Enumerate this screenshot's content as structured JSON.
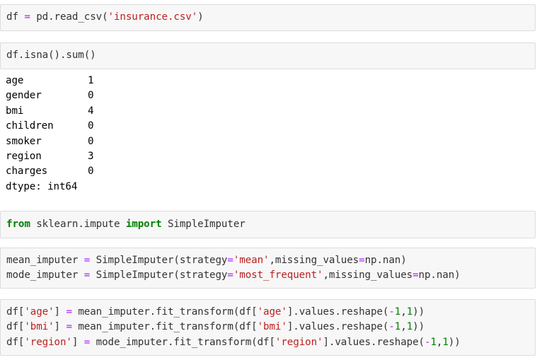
{
  "cells": [
    {
      "lines": [
        [
          {
            "t": "df "
          },
          {
            "t": "=",
            "c": "t-op"
          },
          {
            "t": " pd.read_csv("
          },
          {
            "t": "'insurance.csv'",
            "c": "t-str"
          },
          {
            "t": ")"
          }
        ]
      ]
    },
    {
      "lines": [
        [
          {
            "t": "df.isna().sum()"
          }
        ]
      ]
    },
    {
      "lines": [
        [
          {
            "t": "from",
            "c": "t-kw"
          },
          {
            "t": " sklearn.impute "
          },
          {
            "t": "import",
            "c": "t-kw"
          },
          {
            "t": " SimpleImputer"
          }
        ]
      ]
    },
    {
      "lines": [
        [
          {
            "t": "mean_imputer "
          },
          {
            "t": "=",
            "c": "t-op"
          },
          {
            "t": " SimpleImputer(strategy"
          },
          {
            "t": "=",
            "c": "t-op"
          },
          {
            "t": "'mean'",
            "c": "t-str"
          },
          {
            "t": ",missing_values"
          },
          {
            "t": "=",
            "c": "t-op"
          },
          {
            "t": "np.nan)"
          }
        ],
        [
          {
            "t": "mode_imputer "
          },
          {
            "t": "=",
            "c": "t-op"
          },
          {
            "t": " SimpleImputer(strategy"
          },
          {
            "t": "=",
            "c": "t-op"
          },
          {
            "t": "'most_frequent'",
            "c": "t-str"
          },
          {
            "t": ",missing_values"
          },
          {
            "t": "=",
            "c": "t-op"
          },
          {
            "t": "np.nan)"
          }
        ]
      ]
    },
    {
      "lines": [
        [
          {
            "t": "df["
          },
          {
            "t": "'age'",
            "c": "t-str"
          },
          {
            "t": "] "
          },
          {
            "t": "=",
            "c": "t-op"
          },
          {
            "t": " mean_imputer.fit_transform(df["
          },
          {
            "t": "'age'",
            "c": "t-str"
          },
          {
            "t": "].values.reshape("
          },
          {
            "t": "-",
            "c": "t-op"
          },
          {
            "t": "1",
            "c": "t-num"
          },
          {
            "t": ","
          },
          {
            "t": "1",
            "c": "t-num"
          },
          {
            "t": "))"
          }
        ],
        [
          {
            "t": "df["
          },
          {
            "t": "'bmi'",
            "c": "t-str"
          },
          {
            "t": "] "
          },
          {
            "t": "=",
            "c": "t-op"
          },
          {
            "t": " mean_imputer.fit_transform(df["
          },
          {
            "t": "'bmi'",
            "c": "t-str"
          },
          {
            "t": "].values.reshape("
          },
          {
            "t": "-",
            "c": "t-op"
          },
          {
            "t": "1",
            "c": "t-num"
          },
          {
            "t": ","
          },
          {
            "t": "1",
            "c": "t-num"
          },
          {
            "t": "))"
          }
        ],
        [
          {
            "t": "df["
          },
          {
            "t": "'region'",
            "c": "t-str"
          },
          {
            "t": "] "
          },
          {
            "t": "=",
            "c": "t-op"
          },
          {
            "t": " mode_imputer.fit_transform(df["
          },
          {
            "t": "'region'",
            "c": "t-str"
          },
          {
            "t": "].values.reshape("
          },
          {
            "t": "-",
            "c": "t-op"
          },
          {
            "t": "1",
            "c": "t-num"
          },
          {
            "t": ","
          },
          {
            "t": "1",
            "c": "t-num"
          },
          {
            "t": "))"
          }
        ]
      ]
    }
  ],
  "output": {
    "rows": [
      {
        "key": "age",
        "val": "1"
      },
      {
        "key": "gender",
        "val": "0"
      },
      {
        "key": "bmi",
        "val": "4"
      },
      {
        "key": "children",
        "val": "0"
      },
      {
        "key": "smoker",
        "val": "0"
      },
      {
        "key": "region",
        "val": "3"
      },
      {
        "key": "charges",
        "val": "0"
      }
    ],
    "dtype": "dtype: int64"
  },
  "colors": {
    "operator": "#aa22ff",
    "string": "#ba2121",
    "keyword": "#008000",
    "number": "#008000",
    "cell_bg": "#f7f7f7",
    "cell_border": "#dcdcdc"
  }
}
